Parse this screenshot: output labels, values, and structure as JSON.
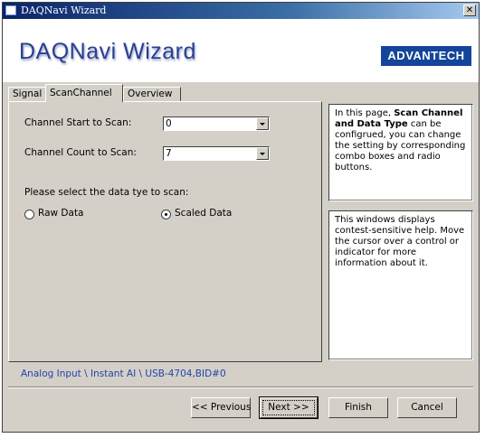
{
  "window": {
    "title": "DAQNavi Wizard",
    "close_glyph": "✕"
  },
  "header": {
    "title": "DAQNavi Wizard",
    "logo": "ADVANTECH"
  },
  "tabs": [
    {
      "label": "Signal"
    },
    {
      "label": "ScanChannel",
      "active": true
    },
    {
      "label": "Overview"
    }
  ],
  "form": {
    "channel_start_label": "Channel Start to Scan:",
    "channel_start_value": "0",
    "channel_count_label": "Channel Count to Scan:",
    "channel_count_value": "7",
    "data_type_prompt": "Please select the data tye to scan:",
    "raw_label": "Raw Data",
    "scaled_label": "Scaled Data",
    "selected": "scaled"
  },
  "help": {
    "top_prefix": "In this page, ",
    "top_bold": "Scan Channel and Data Type",
    "top_suffix": " can be configrued, you can change the setting by corresponding combo boxes and radio buttons.",
    "bottom": "This windows displays contest-sensitive help. Move the cursor over a control or indicator for more information about it."
  },
  "status_path": "Analog Input \\ Instant AI \\ USB-4704,BID#0",
  "buttons": {
    "previous": "<< Previous",
    "next": "Next >>",
    "finish": "Finish",
    "cancel": "Cancel"
  },
  "icons": {
    "dropdown": "chevron-down-icon",
    "close": "close-icon"
  }
}
